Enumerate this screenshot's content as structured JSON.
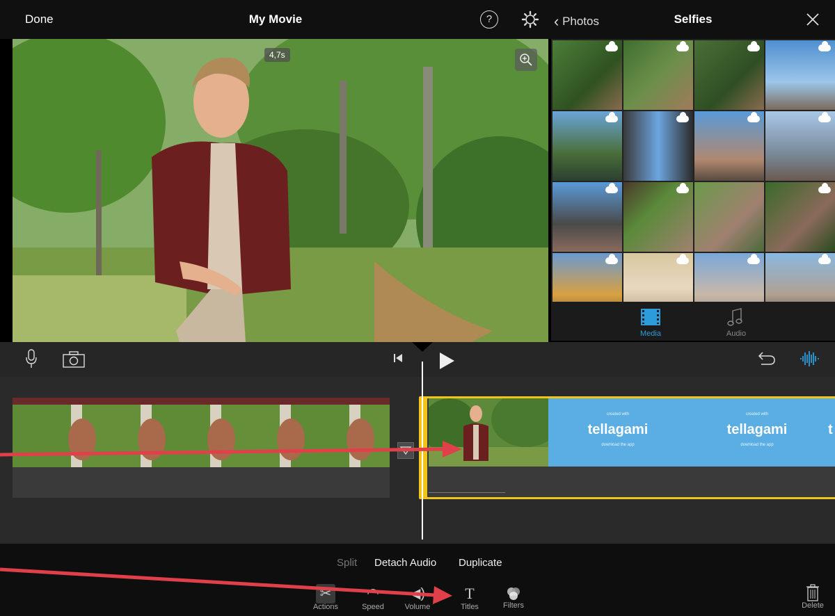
{
  "editor": {
    "done_label": "Done",
    "title": "My Movie",
    "help_label": "?",
    "clip_duration": "4,7s"
  },
  "photos": {
    "back_label": "Photos",
    "album_title": "Selfies",
    "tabs": [
      {
        "label": "Media",
        "active": true
      },
      {
        "label": "Audio",
        "active": false
      }
    ]
  },
  "timeline": {
    "tellagami_tiles": [
      {
        "top_text": "created with",
        "logo": "tellagami",
        "bottom_text": "download the app"
      },
      {
        "top_text": "created with",
        "logo": "tellagami",
        "bottom_text": "download the app"
      }
    ],
    "partial_tile_letter": "t"
  },
  "actions": {
    "split_label": "Split",
    "detach_audio_label": "Detach Audio",
    "duplicate_label": "Duplicate"
  },
  "toolbar": {
    "tools": [
      {
        "label": "Actions",
        "icon": "scissors-icon"
      },
      {
        "label": "Speed",
        "icon": "speed-icon"
      },
      {
        "label": "Volume",
        "icon": "volume-icon"
      },
      {
        "label": "Titles",
        "icon": "titles-icon"
      },
      {
        "label": "Filters",
        "icon": "filters-icon"
      }
    ],
    "delete_label": "Delete"
  },
  "colors": {
    "accent": "#2d9cdb",
    "selection": "#f0c419",
    "annotation_arrow": "#e0404a",
    "tellagami_blue": "#5aaee3"
  }
}
